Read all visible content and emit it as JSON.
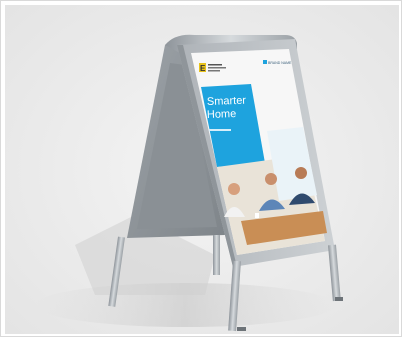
{
  "poster": {
    "headline_line1": "Smarter",
    "headline_line2": "Home",
    "brand_label": "BRAND NAME",
    "logo_letter": "E"
  },
  "colors": {
    "background": "#ececec",
    "frame_silver": "#b9bec3",
    "poster_blue": "#1ea3de",
    "poster_white": "#f7f7f7"
  }
}
